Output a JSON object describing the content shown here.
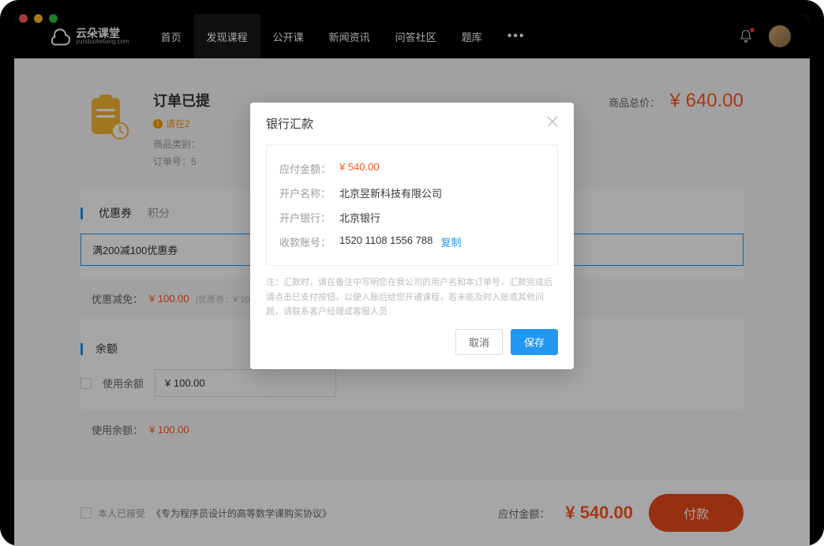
{
  "logo": {
    "name": "云朵课堂",
    "sub": "yunduoketang.com"
  },
  "nav": {
    "items": [
      "首页",
      "发现课程",
      "公开课",
      "新闻资讯",
      "问答社区",
      "题库"
    ],
    "activeIndex": 1
  },
  "order": {
    "title": "订单已提",
    "warn": "请在2",
    "metaCat": "商品类别：",
    "metaNo": "订单号：5",
    "totalLabel": "商品总价：",
    "totalValue": "¥ 640.00"
  },
  "coupon": {
    "tabCoupon": "优惠券",
    "tabPoints": "积分",
    "selected": "满200减100优惠券",
    "reductionLabel": "优惠减免：",
    "reductionValue": "¥ 100.00",
    "reductionHint": "(优惠券：¥ 10"
  },
  "balance": {
    "title": "余额",
    "useLabel": "使用余额",
    "inputValue": "¥ 100.00",
    "usedLabel": "使用余额：",
    "usedValue": "¥ 100.00"
  },
  "footer": {
    "agreePrefix": "本人已接受",
    "agreeLink": "《专为程序员设计的高等数学课购买协议》",
    "payLabel": "应付金额：",
    "payAmount": "¥ 540.00",
    "payBtn": "付款"
  },
  "modal": {
    "title": "银行汇款",
    "rows": {
      "amountKey": "应付金额：",
      "amountVal": "¥ 540.00",
      "nameKey": "开户名称：",
      "nameVal": "北京昱新科技有限公司",
      "bankKey": "开户银行：",
      "bankVal": "北京银行",
      "acctKey": "收款账号：",
      "acctVal": "1520 1108 1556 788",
      "copy": "复制"
    },
    "note": "注：汇款时，请在备注中写明您在我公司的用户名和本订单号，汇款完成后请点击已支付按钮，以便入账后给您开通课程，若未能及时入账或其他问题，请联系客户经理或客服人员",
    "cancel": "取消",
    "save": "保存"
  }
}
